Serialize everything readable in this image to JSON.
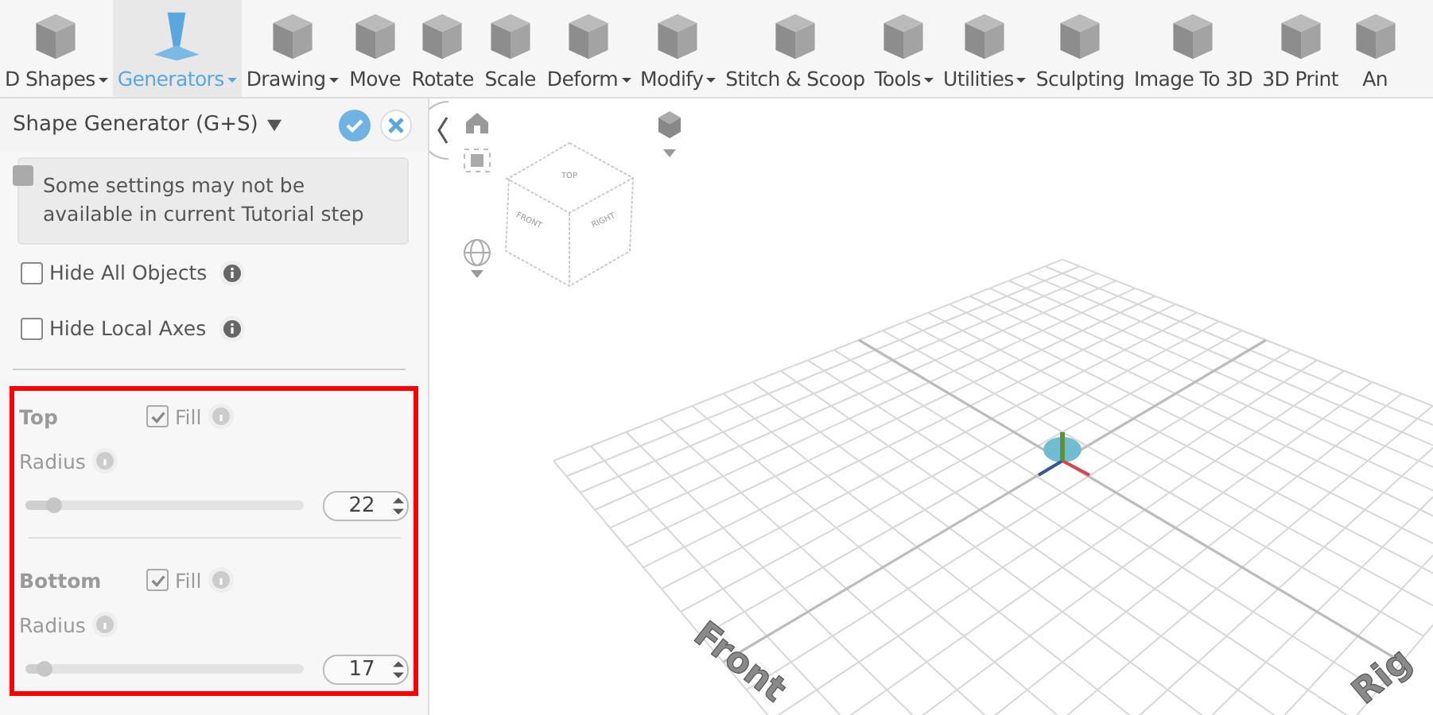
{
  "toolbar": [
    {
      "label": "D Shapes",
      "dropdown": true,
      "selected": false
    },
    {
      "label": "Generators",
      "dropdown": true,
      "selected": true
    },
    {
      "label": "Drawing",
      "dropdown": true,
      "selected": false
    },
    {
      "label": "Move",
      "dropdown": false,
      "selected": false
    },
    {
      "label": "Rotate",
      "dropdown": false,
      "selected": false
    },
    {
      "label": "Scale",
      "dropdown": false,
      "selected": false
    },
    {
      "label": "Deform",
      "dropdown": true,
      "selected": false
    },
    {
      "label": "Modify",
      "dropdown": true,
      "selected": false
    },
    {
      "label": "Stitch & Scoop",
      "dropdown": false,
      "selected": false
    },
    {
      "label": "Tools",
      "dropdown": true,
      "selected": false
    },
    {
      "label": "Utilities",
      "dropdown": true,
      "selected": false
    },
    {
      "label": "Sculpting",
      "dropdown": false,
      "selected": false
    },
    {
      "label": "Image To 3D",
      "dropdown": false,
      "selected": false
    },
    {
      "label": "3D Print",
      "dropdown": false,
      "selected": false
    },
    {
      "label": "An",
      "dropdown": false,
      "selected": false
    }
  ],
  "panel": {
    "title": "Shape Generator (G+S)",
    "notice": "Some settings may not be available in current Tutorial step",
    "options": [
      {
        "label": "Hide All Objects",
        "checked": false
      },
      {
        "label": "Hide Local Axes",
        "checked": false
      }
    ],
    "sections": [
      {
        "title": "Top",
        "disabled": true,
        "fill_label": "Fill",
        "fill": true,
        "radius_label": "Radius",
        "level": 0.1,
        "value": "22"
      },
      {
        "title": "Bottom",
        "disabled": true,
        "fill_label": "Fill",
        "fill": true,
        "radius_label": "Radius",
        "level": 0.07,
        "value": "17"
      }
    ]
  },
  "viewport": {
    "cube_faces": [
      "TOP",
      "FRONT",
      "RIGHT"
    ],
    "floor_labels": [
      "Front",
      "Rig"
    ]
  }
}
